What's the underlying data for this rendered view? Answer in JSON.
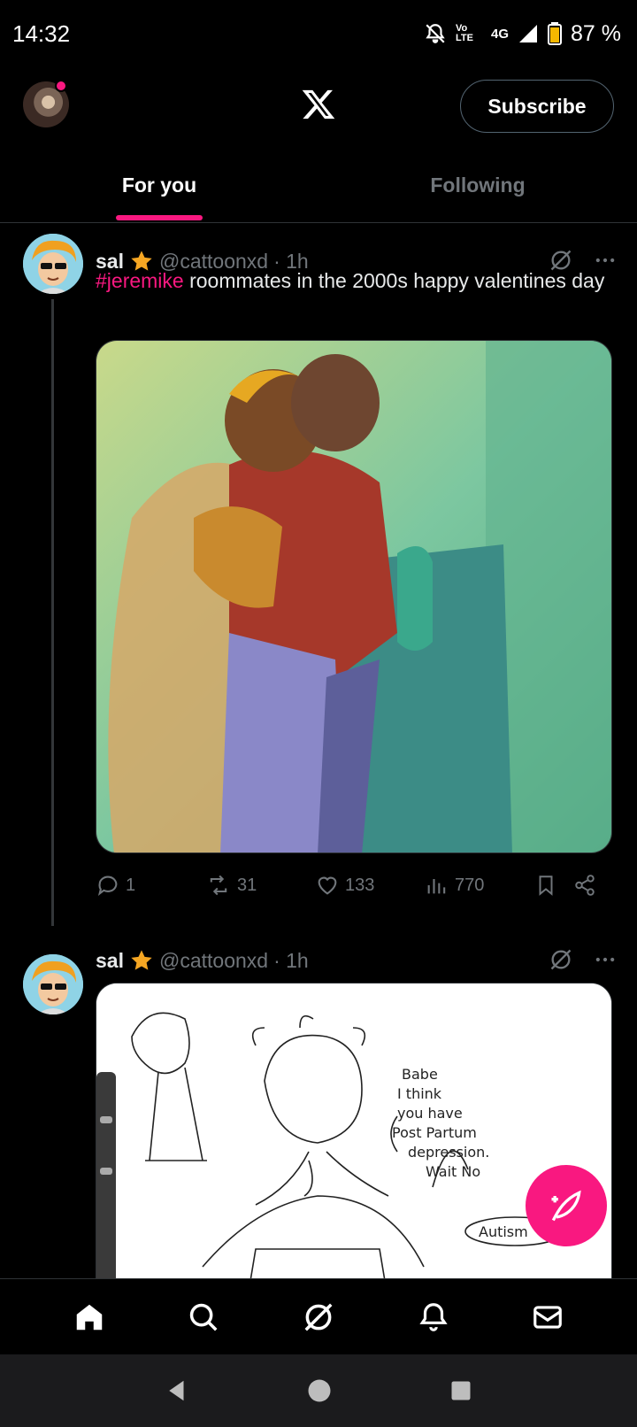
{
  "status": {
    "time": "14:32",
    "network": "4G",
    "volte": "Vo LTE",
    "battery": "87 %"
  },
  "header": {
    "subscribe_label": "Subscribe"
  },
  "tabs": [
    {
      "label": "For you",
      "active": true
    },
    {
      "label": "Following",
      "active": false
    }
  ],
  "posts": [
    {
      "name": "sal",
      "handle": "@cattoonxd",
      "time": "· 1h",
      "hashtag": "#jeremike",
      "text": " roommates in the 2000s happy valentines day",
      "stats": {
        "replies": "1",
        "reposts": "31",
        "likes": "133",
        "views": "770"
      }
    },
    {
      "name": "sal",
      "handle": "@cattoonxd",
      "time": "· 1h",
      "sketch_text": {
        "speech": [
          "Babe",
          "I think",
          "you have",
          "Post Partum",
          "depression.",
          "Wait No"
        ],
        "label": "Autism"
      }
    }
  ],
  "colors": {
    "accent": "#f91880",
    "muted": "#71767b",
    "background": "#000000"
  },
  "icons": [
    "muted-bell-icon",
    "signal-icon",
    "battery-icon",
    "x-logo-icon",
    "grok-icon",
    "more-icon",
    "reply-icon",
    "repost-icon",
    "like-icon",
    "views-icon",
    "bookmark-icon",
    "share-icon",
    "compose-icon",
    "home-icon",
    "search-icon",
    "notifications-icon",
    "messages-icon",
    "back-icon",
    "home-circle-icon",
    "recents-icon"
  ]
}
